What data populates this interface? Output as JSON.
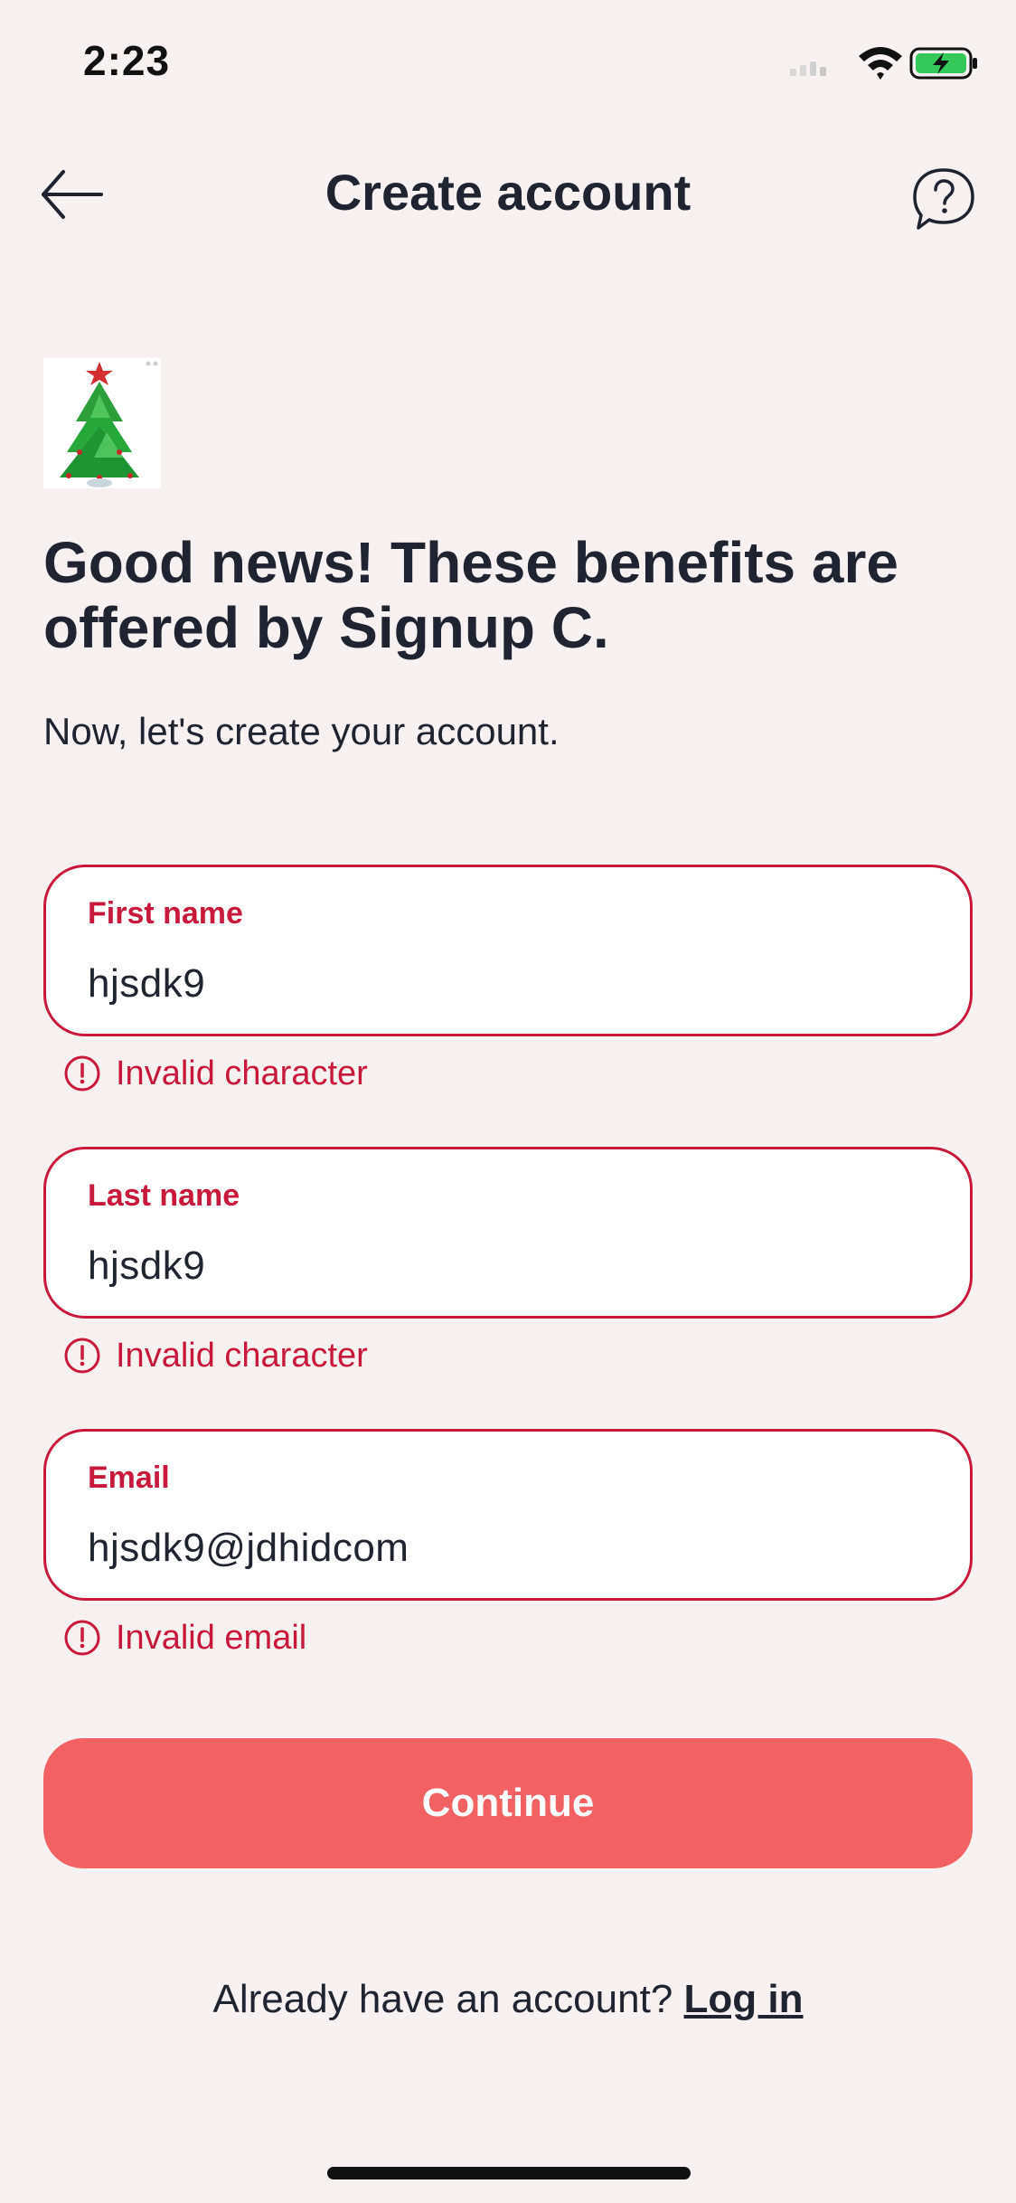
{
  "status_bar": {
    "time": "2:23",
    "icons": [
      "signal-icon",
      "wifi-icon",
      "battery-charging-icon"
    ]
  },
  "header": {
    "title": "Create account",
    "back_icon": "arrow-left-icon",
    "help_icon": "question-circle-icon"
  },
  "hero": {
    "image": "christmas-tree-image",
    "headline": "Good news! These benefits are offered by Signup C.",
    "subtext": "Now, let's create your account."
  },
  "form": {
    "fields": [
      {
        "label": "First name",
        "value": "hjsdk9",
        "error": "Invalid character"
      },
      {
        "label": "Last name",
        "value": "hjsdk9",
        "error": "Invalid character"
      },
      {
        "label": "Email",
        "value": "hjsdk9@jdhidcom",
        "error": "Invalid email"
      }
    ],
    "continue_label": "Continue"
  },
  "footer": {
    "prompt": "Already have an account?",
    "login_label": "Log in"
  },
  "colors": {
    "background": "#f7f2f1",
    "error": "#c8193c",
    "button": "#f26262",
    "text": "#1f2430"
  }
}
